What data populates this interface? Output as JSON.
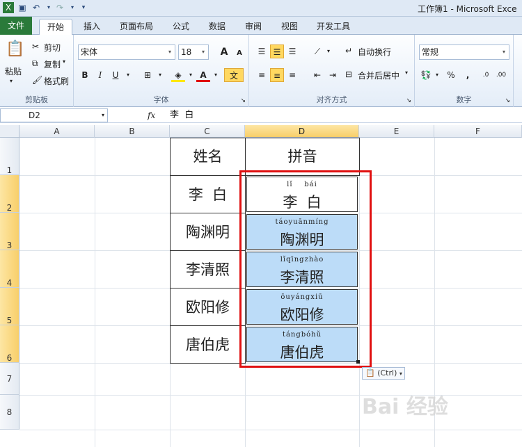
{
  "window": {
    "title": "工作簿1 - Microsoft Exce"
  },
  "tabs": [
    {
      "label": "文件"
    },
    {
      "label": "开始"
    },
    {
      "label": "插入"
    },
    {
      "label": "页面布局"
    },
    {
      "label": "公式"
    },
    {
      "label": "数据"
    },
    {
      "label": "审阅"
    },
    {
      "label": "视图"
    },
    {
      "label": "开发工具"
    }
  ],
  "ribbon": {
    "clipboard": {
      "label": "剪贴板",
      "paste": "粘贴",
      "cut": "剪切",
      "copy": "复制",
      "format_painter": "格式刷"
    },
    "font": {
      "label": "字体",
      "name": "宋体",
      "size": "18",
      "bold": "B",
      "italic": "I",
      "underline": "U",
      "grow": "A",
      "shrink": "A",
      "wen": "文"
    },
    "alignment": {
      "label": "对齐方式",
      "wrap": "自动换行",
      "merge": "合并后居中"
    },
    "number": {
      "label": "数字",
      "format": "常规",
      "percent": "%",
      "comma": ",",
      "inc": ".0",
      "dec": ".00"
    }
  },
  "formula_bar": {
    "name_box": "D2",
    "fx": "fx",
    "value": "李  白"
  },
  "sheet": {
    "columns": [
      "A",
      "B",
      "C",
      "D",
      "E",
      "F"
    ],
    "rows": [
      "1",
      "2",
      "3",
      "4",
      "5",
      "6",
      "7",
      "8"
    ],
    "header": {
      "name": "姓名",
      "pinyin": "拼音"
    },
    "names": [
      "李  白",
      "陶渊明",
      "李清照",
      "欧阳修",
      "唐伯虎"
    ],
    "pinyin_cells": [
      {
        "pinyin": "lǐ    bái",
        "hanzi": "李  白"
      },
      {
        "pinyin": "táoyuānmíng",
        "hanzi": "陶渊明"
      },
      {
        "pinyin": "lǐqīngzhào",
        "hanzi": "李清照"
      },
      {
        "pinyin": "ōuyángxiū",
        "hanzi": "欧阳修"
      },
      {
        "pinyin": "tángbóhǔ",
        "hanzi": "唐伯虎"
      }
    ]
  },
  "paste_options": {
    "label": "(Ctrl)"
  },
  "watermark": {
    "text": "Bai 经验"
  }
}
